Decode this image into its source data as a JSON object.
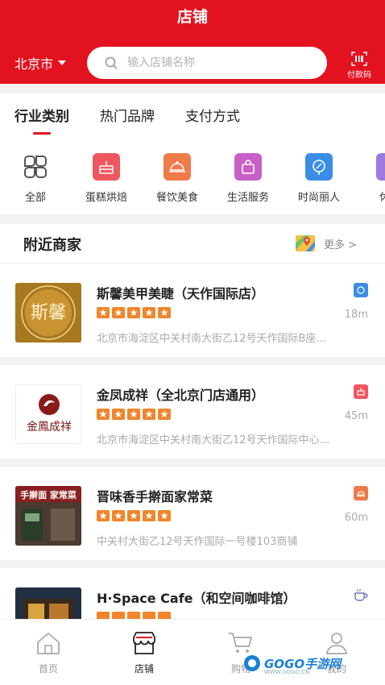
{
  "header": {
    "title": "店铺",
    "city": "北京市",
    "search_placeholder": "输入店铺名称",
    "paycode_label": "付款码"
  },
  "tabs": [
    {
      "label": "行业类别",
      "active": true
    },
    {
      "label": "热门品牌",
      "active": false
    },
    {
      "label": "支付方式",
      "active": false
    }
  ],
  "categories": [
    {
      "label": "全部",
      "icon": "grid-icon",
      "color": "#555555"
    },
    {
      "label": "蛋糕烘焙",
      "icon": "cake-icon",
      "color": "#f0565f"
    },
    {
      "label": "餐饮美食",
      "icon": "food-cover-icon",
      "color": "#f07a4a"
    },
    {
      "label": "生活服务",
      "icon": "bag-icon",
      "color": "#c85fc8"
    },
    {
      "label": "时尚丽人",
      "icon": "mirror-icon",
      "color": "#3a8ee6"
    },
    {
      "label": "休闲",
      "icon": "leisure-icon",
      "color": "#9b7be0"
    }
  ],
  "nearby": {
    "title": "附近商家",
    "more_label": "更多 >",
    "merchants": [
      {
        "name": "斯馨美甲美睫（天作国际店）",
        "distance": "18m",
        "address": "北京市海淀区中关村南大街乙12号天作国际B座…",
        "rating": 5,
        "badge_icon": "mirror-icon",
        "badge_color": "#3a8ee6",
        "thumb_text": "斯馨"
      },
      {
        "name": "金凤成祥（全北京门店通用）",
        "distance": "45m",
        "address": "北京市海淀区中关村南大街乙12号天作国际中心…",
        "rating": 5,
        "badge_icon": "cake-icon",
        "badge_color": "#f0565f",
        "thumb_text": "金鳳成祥"
      },
      {
        "name": "晋味香手擀面家常菜",
        "distance": "60m",
        "address": "中关村大街乙12号天作国际一号楼103商铺",
        "rating": 5,
        "badge_icon": "food-cover-icon",
        "badge_color": "#f07a4a",
        "thumb_text": "手擀面 家常菜"
      },
      {
        "name": "H·Space Cafe（和空间咖啡馆）",
        "distance": "",
        "address": "",
        "rating": 5,
        "badge_icon": "coffee-icon",
        "badge_color": "#6a7ab0",
        "thumb_text": ""
      }
    ]
  },
  "bottom_nav": [
    {
      "label": "首页",
      "icon": "home-icon",
      "active": false
    },
    {
      "label": "店铺",
      "icon": "store-icon",
      "active": true
    },
    {
      "label": "购物",
      "icon": "cart-icon",
      "active": false
    },
    {
      "label": "我的",
      "icon": "user-icon",
      "active": false
    }
  ],
  "watermark": {
    "text": "GOGO手游网",
    "sub": "WWW.GOGO.CN"
  }
}
